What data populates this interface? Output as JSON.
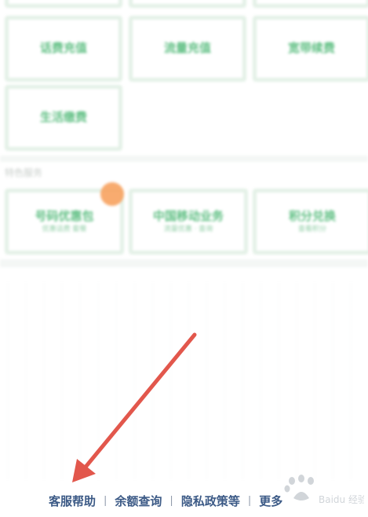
{
  "tiles_row_top": [
    {
      "label": "",
      "sub": ""
    },
    {
      "label": "",
      "sub": ""
    },
    {
      "label": "",
      "sub": ""
    }
  ],
  "tiles_row1": [
    {
      "label": "话费充值",
      "sub": ""
    },
    {
      "label": "流量充值",
      "sub": ""
    },
    {
      "label": "宽带续费",
      "sub": ""
    }
  ],
  "tiles_row2": [
    {
      "label": "生活缴费",
      "sub": ""
    }
  ],
  "section": {
    "label": "特色服务"
  },
  "tiles_row3": [
    {
      "label": "号码优惠包",
      "sub": "优惠话费 套餐"
    },
    {
      "label": "中国移动业务",
      "sub": "流量优惠 · 查询"
    },
    {
      "label": "积分兑换",
      "sub": "查看积分"
    }
  ],
  "footer": {
    "links": [
      "客服帮助",
      "余额查询",
      "隐私政策等",
      "更多"
    ],
    "separator": "|"
  },
  "watermark": {
    "text": "Baidu 经验"
  },
  "colors": {
    "tile_border": "#e4f1e7",
    "tile_text": "#5fbf83",
    "footer_text": "#3c5a86",
    "arrow": "#e2574c",
    "badge": "#f7a25f"
  },
  "icons": [
    "arrow-annotation-icon",
    "baidu-paw-watermark-icon",
    "orange-badge-icon"
  ]
}
